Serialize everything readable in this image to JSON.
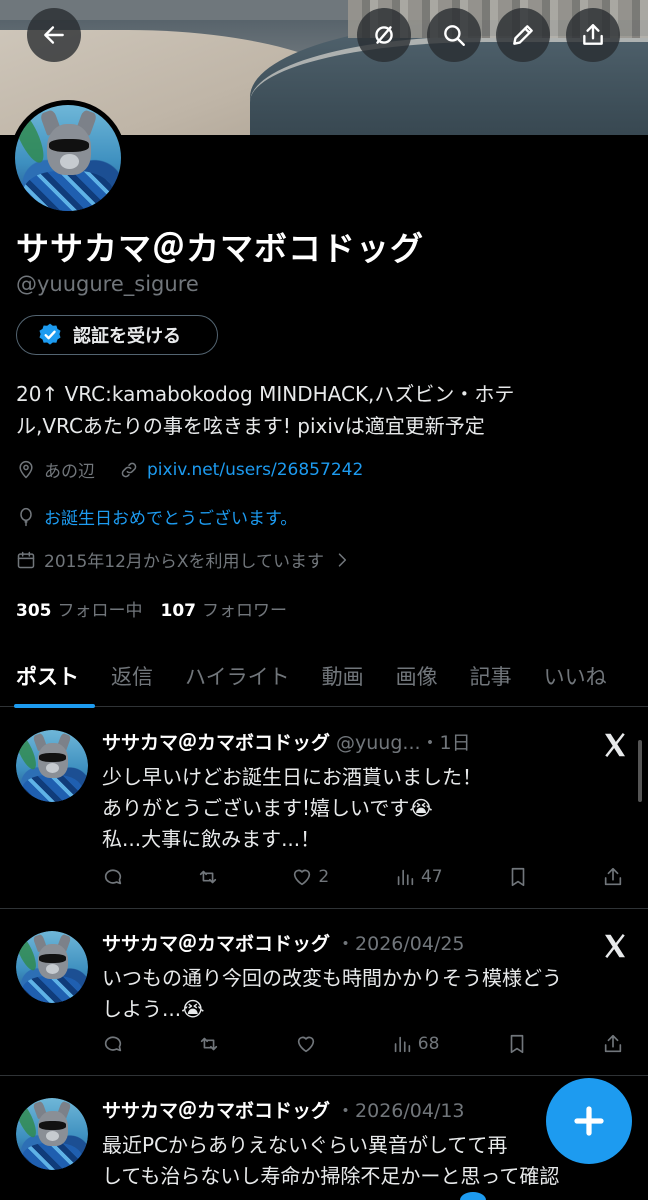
{
  "profile": {
    "name": "ササカマ＠カマボコドッグ",
    "handle": "@yuugure_sigure",
    "verify_label": "認証を受ける",
    "bio_line1": "20↑ VRC:kamabokodog MINDHACK,ハズビン・ホテ",
    "bio_line2": "ル,VRCあたりの事を呟きます! pixivは適宜更新予定",
    "location": "あの辺",
    "website": "pixiv.net/users/26857242",
    "birthday": "お誕生日おめでとうございます。",
    "joined": "2015年12月からXを利用しています",
    "following_count": "305",
    "following_label": "フォロー中",
    "followers_count": "107",
    "followers_label": "フォロワー"
  },
  "tabs": [
    "ポスト",
    "返信",
    "ハイライト",
    "動画",
    "画像",
    "記事",
    "いいね"
  ],
  "posts": [
    {
      "name": "ササカマ＠カマボコドッグ",
      "handle_time": "@yuug...・1日",
      "lines": [
        "少し早いけどお誕生日にお酒貰いました！",
        "ありがとうございます!嬉しいです😭",
        "私...大事に飲みます...！"
      ],
      "replies": "",
      "reposts": "",
      "likes": "2",
      "views": "47"
    },
    {
      "name": "ササカマ＠カマボコドッグ",
      "handle_time": "・2026/04/25",
      "lines": [
        "いつもの通り今回の改変も時間かかりそう模様どう",
        "しよう...😭"
      ],
      "replies": "",
      "reposts": "",
      "likes": "",
      "views": "68"
    },
    {
      "name": "ササカマ＠カマボコドッグ",
      "handle_time": "・2026/04/13",
      "lines": [
        "最近PCからありえないぐらい異音がしてて再",
        "しても治らないし寿命か掃除不足かーと思って確認"
      ]
    }
  ],
  "colors": {
    "accent": "#1d9bf0",
    "muted": "#71767b",
    "background": "#000000",
    "divider": "#2f3336"
  },
  "icons": [
    "back-arrow-icon",
    "mute-icon",
    "search-icon",
    "edit-icon",
    "share-icon",
    "verified-badge-icon",
    "location-icon",
    "link-icon",
    "balloon-icon",
    "calendar-icon",
    "chevron-right-icon",
    "x-logo-icon",
    "reply-icon",
    "repost-icon",
    "like-icon",
    "views-icon",
    "bookmark-icon",
    "compose-plus-icon"
  ]
}
